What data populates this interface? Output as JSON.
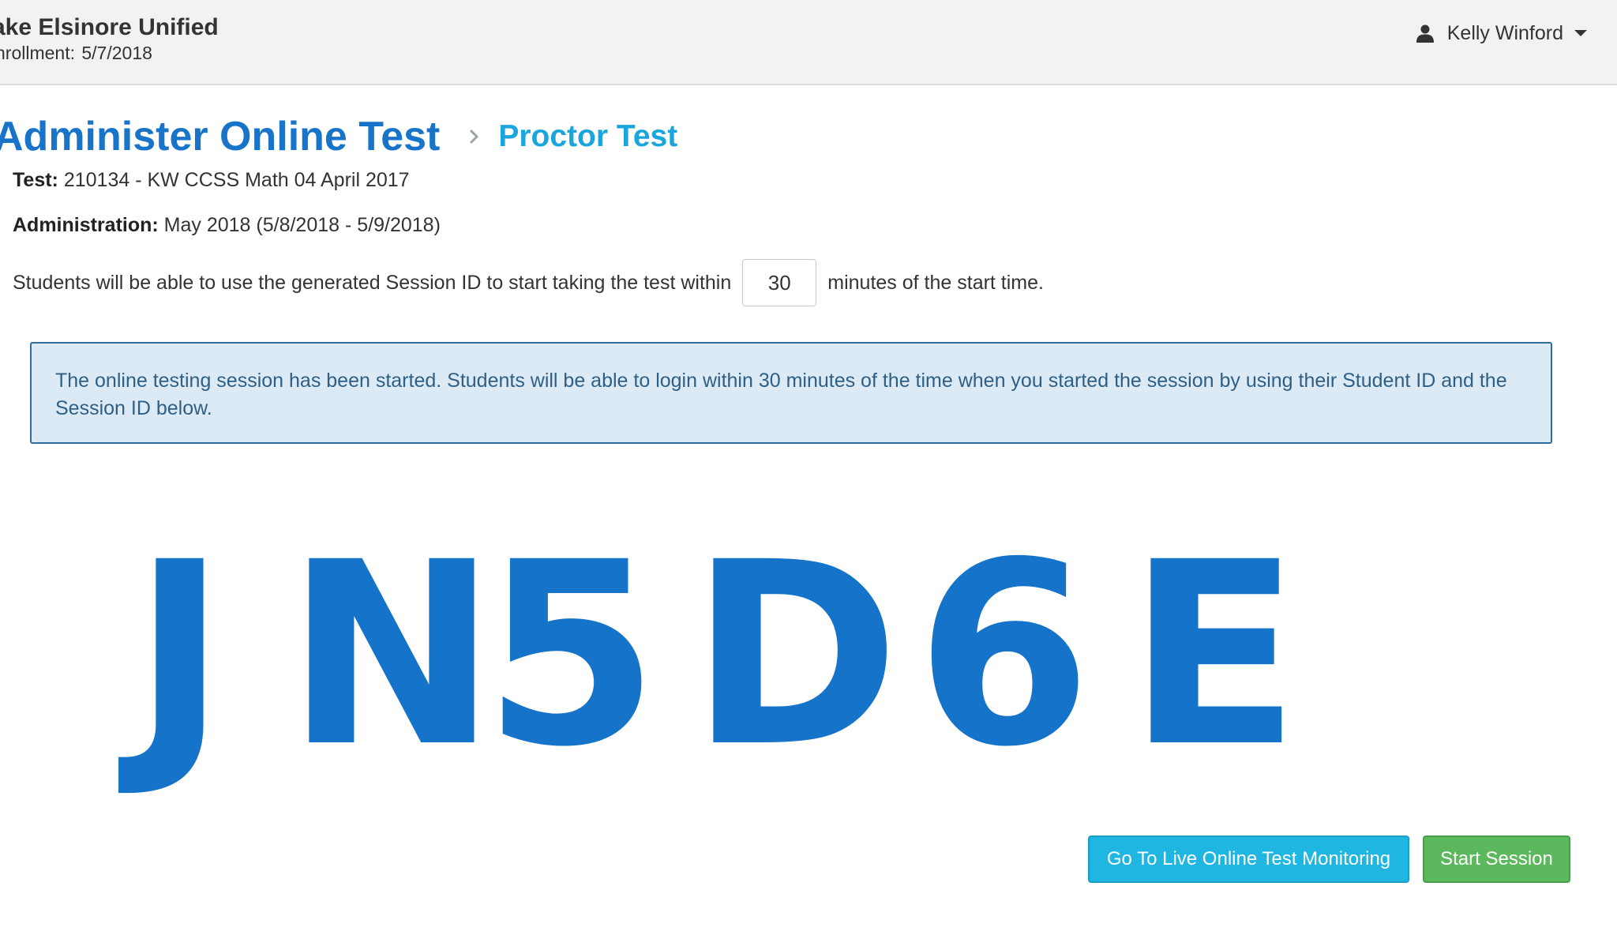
{
  "header": {
    "district": "ake Elsinore Unified",
    "enrollment_label": "nrollment:",
    "enrollment_date": "5/7/2018",
    "user_name": "Kelly Winford",
    "user_icon": "user-icon",
    "menu_icon": "caret-down-icon"
  },
  "breadcrumb": {
    "title": "Administer Online Test",
    "separator_icon": "chevron-right-icon",
    "current": "Proctor Test"
  },
  "test": {
    "label": "Test:",
    "value": "210134 - KW CCSS Math 04 April 2017"
  },
  "administration": {
    "label": "Administration:",
    "value": "May 2018 (5/8/2018 - 5/9/2018)"
  },
  "session_window": {
    "prefix": "Students will be able to use the generated Session ID to start taking the test within",
    "minutes": "30",
    "suffix": "minutes of the start time."
  },
  "alert": {
    "message": "The online testing session has been started. Students will be able to login within 30 minutes of the time when you started the session by using their Student ID and the Session ID below."
  },
  "session_id": [
    "J",
    "N",
    "5",
    "D",
    "6",
    "E"
  ],
  "buttons": {
    "monitor": "Go To Live Online Test Monitoring",
    "start": "Start Session"
  },
  "colors": {
    "title_blue": "#1874c9",
    "breadcrumb_cyan": "#1aa6dc",
    "session_blue": "#1574ca",
    "alert_bg": "#dbeaf5",
    "monitor_button": "#1fb6e1",
    "start_button": "#5cb85c"
  }
}
